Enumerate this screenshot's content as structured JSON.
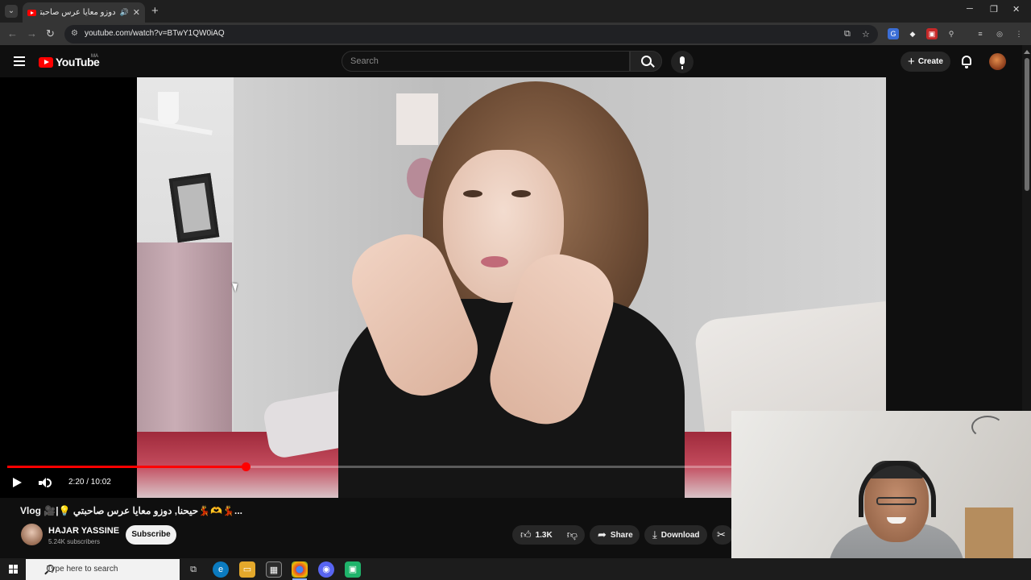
{
  "browser": {
    "tab_title": "دوزو معايا عرس صاحبتي🫶💃",
    "new_tab_symbol": "+",
    "close_symbol": "✕",
    "url": "youtube.com/watch?v=BTwY1QW0iAQ",
    "window": {
      "minimize": "─",
      "restore": "❐",
      "close": "✕"
    }
  },
  "youtube": {
    "logo_text": "YouTube",
    "country_code": "MA",
    "search_placeholder": "Search",
    "create_label": "Create"
  },
  "player": {
    "time": "2:20 / 10:02",
    "progress_percent": 32.9,
    "played_color": "#ff0000"
  },
  "video": {
    "title": "Vlog 🎥|💡 حيحنا, دوزو معايا عرس صاحبتي💃🫶💃...",
    "channel_name": "HAJAR YASSINE",
    "subscribers": "5.24K subscribers",
    "subscribe_label": "Subscribe",
    "like_count": "1.3K",
    "share_label": "Share",
    "download_label": "Download"
  },
  "taskbar": {
    "search_placeholder": "Type here to search"
  },
  "icons": [
    "tab-list-icon",
    "youtube-favicon",
    "audio-icon",
    "back-icon",
    "forward-icon",
    "reload-icon",
    "site-info-icon",
    "cast-icon",
    "bookmark-star-icon",
    "extensions-icon",
    "profile-icon",
    "menu-icon",
    "search-icon",
    "mic-icon",
    "bell-icon",
    "play-icon",
    "volume-icon",
    "like-icon",
    "dislike-icon",
    "share-icon",
    "download-icon",
    "clip-icon",
    "windows-start-icon"
  ]
}
